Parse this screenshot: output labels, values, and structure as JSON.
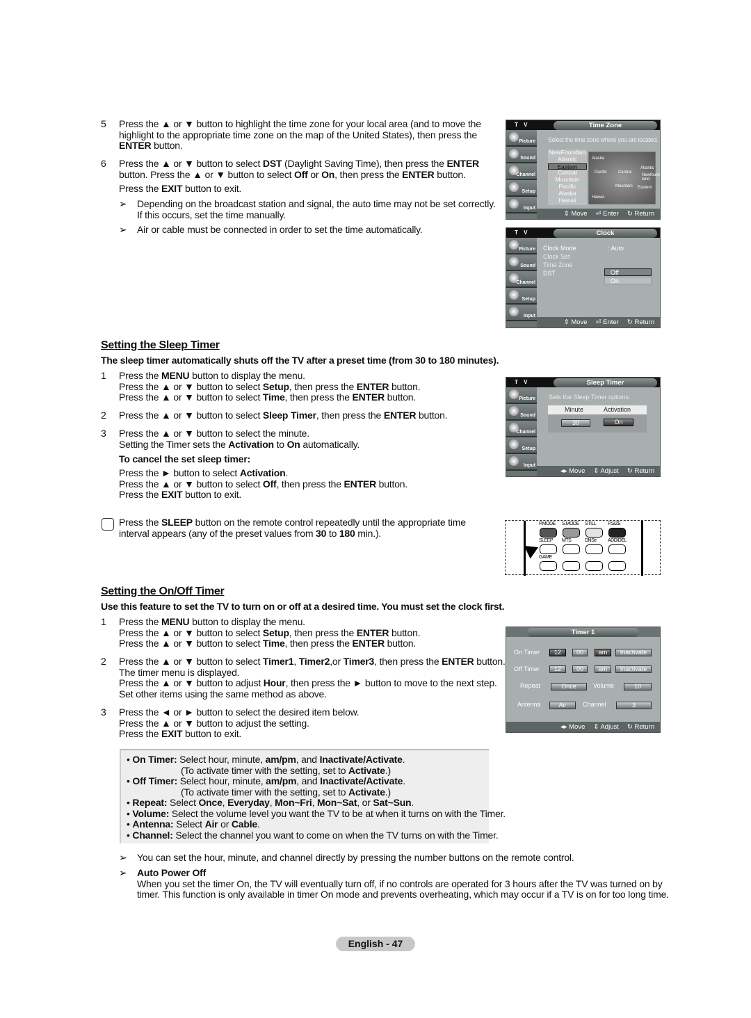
{
  "clock_steps": [
    {
      "num": "5",
      "lines": [
        [
          "Press the ▲ or ▼ button to highlight the time zone for your local area (and to move the"
        ],
        [
          "highlight to the appropriate time zone on the map of the United States), then press the"
        ],
        [
          "",
          "ENTER",
          " button."
        ]
      ]
    },
    {
      "num": "6",
      "lines": [
        [
          "Press the ▲ or ▼ button to select ",
          "DST",
          " (Daylight Saving Time), then press the ",
          "ENTER"
        ],
        [
          "button. Press the ▲ or ▼ button to select ",
          "Off",
          " or ",
          "On",
          ", then press the ",
          "ENTER",
          " button."
        ]
      ]
    },
    {
      "num": "",
      "lines": [
        [
          "Press the ",
          "EXIT",
          " button to exit."
        ]
      ]
    }
  ],
  "clock_notes": [
    {
      "arrow": "➢",
      "lines": [
        [
          "Depending on the broadcast station and signal, the auto time may not be set correctly."
        ],
        [
          "If this occurs, set the time manually."
        ]
      ]
    },
    {
      "arrow": "➢",
      "lines": [
        [
          "Air or cable must be connected in order to set the time automatically."
        ]
      ]
    }
  ],
  "sleep": {
    "heading": "Setting the Sleep Timer",
    "intro": "The sleep timer automatically shuts off the TV after a preset time (from 30 to 180 minutes).",
    "steps": [
      {
        "num": "1",
        "lines": [
          [
            "Press the ",
            "MENU",
            " button to display the menu."
          ],
          [
            "Press the ▲ or ▼ button to select ",
            "Setup",
            ", then press the ",
            "ENTER",
            " button."
          ],
          [
            "Press the ▲ or ▼ button to select ",
            "Time",
            ", then press the ",
            "ENTER",
            " button."
          ]
        ]
      },
      {
        "num": "2",
        "lines": [
          [
            "Press the ▲ or ▼ button to select ",
            "Sleep Timer",
            ", then press the ",
            "ENTER",
            " button."
          ]
        ]
      },
      {
        "num": "3",
        "lines": [
          [
            "Press the ▲ or ▼ button to select the minute."
          ],
          [
            "Setting the Timer sets the ",
            "Activation",
            " to ",
            "On",
            " automatically."
          ]
        ]
      },
      {
        "num": "",
        "lines": [
          [
            "",
            "To cancel the set sleep timer:"
          ]
        ]
      },
      {
        "num": "",
        "lines": [
          [
            "Press the ► button to select ",
            "Activation",
            "."
          ],
          [
            "Press the ▲ or ▼ button to select ",
            "Off",
            ", then press the ",
            "ENTER",
            " button."
          ],
          [
            "Press the ",
            "EXIT",
            " button to exit."
          ]
        ]
      }
    ],
    "remote_note": {
      "lines": [
        [
          "Press the ",
          "SLEEP",
          " button on the remote control repeatedly until the appropriate time"
        ],
        [
          "interval appears (any of the preset values from ",
          "30",
          " to ",
          "180",
          " min.)."
        ]
      ]
    }
  },
  "onoff": {
    "heading": "Setting the On/Off Timer",
    "intro": "Use this feature to set the TV to turn on or off at a desired time. You must set the clock first.",
    "steps": [
      {
        "num": "1",
        "lines": [
          [
            "Press the ",
            "MENU",
            " button to display the menu."
          ],
          [
            "Press the ▲ or ▼ button to select ",
            "Setup",
            ", then press the ",
            "ENTER",
            " button."
          ],
          [
            "Press the ▲ or ▼ button to select ",
            "Time",
            ", then press the ",
            "ENTER",
            " button."
          ]
        ]
      },
      {
        "num": "2",
        "lines": [
          [
            "Press the ▲ or ▼ button to select ",
            "Timer1",
            ", ",
            "Timer2",
            ",or ",
            "Timer3",
            ", then press the ",
            "ENTER",
            " button."
          ],
          [
            "The timer menu is displayed."
          ],
          [
            "Press the ▲ or ▼ button to adjust ",
            "Hour",
            ", then press the ► button to move to the next step."
          ],
          [
            "Set other items using the same method as above."
          ]
        ]
      },
      {
        "num": "3",
        "lines": [
          [
            "Press the ◄ or ► button to select the desired item below."
          ],
          [
            "Press the ▲ or ▼ button to adjust the setting."
          ],
          [
            "Press the ",
            "EXIT",
            " button to exit."
          ]
        ]
      }
    ],
    "bullets": [
      [
        "• ",
        "On Timer:",
        " Select hour, minute, ",
        "am/pm",
        ", and ",
        "Inactivate/Activate",
        "."
      ],
      [
        "(To activate timer with the setting, set to ",
        "Activate",
        ".)"
      ],
      [
        "• ",
        "Off Timer:",
        " Select hour, minute, ",
        "am/pm",
        ", and ",
        "Inactivate/Activate",
        "."
      ],
      [
        "(To activate timer with the setting, set to ",
        "Activate",
        ".)"
      ],
      [
        "• ",
        "Repeat:",
        " Select ",
        "Once",
        ", ",
        "Everyday",
        ", ",
        "Mon~Fri",
        ", ",
        "Mon~Sat",
        ", or ",
        "Sat~Sun",
        "."
      ],
      [
        "• ",
        "Volume:",
        " Select the volume level you want the TV to be at when it turns on with the Timer."
      ],
      [
        "• ",
        "Antenna:",
        " Select ",
        "Air",
        " or ",
        "Cable",
        "."
      ],
      [
        "• ",
        "Channel:",
        " Select the channel you want to come on when the TV turns on with the Timer."
      ]
    ],
    "notes": [
      {
        "arrow": "➢",
        "lines": [
          [
            "You can set the hour, minute, and channel directly by pressing the number buttons on the remote control."
          ]
        ]
      },
      {
        "arrow": "➢",
        "lines": [
          [
            "",
            "Auto Power Off"
          ],
          [
            "When you set the timer On, the TV will eventually turn off, if no controls are operated for 3 hours after the TV was turned on by"
          ],
          [
            "timer. This function is only available in timer On mode and prevents overheating, which may occur if a TV is on for too long time."
          ]
        ]
      }
    ]
  },
  "sidebar_tabs": [
    "Picture",
    "Sound",
    "Channel",
    "Setup",
    "Input"
  ],
  "menu_timezone": {
    "tv": "T V",
    "title": "Time Zone",
    "subtitle": "Select the time zone where you are located.",
    "zones": [
      "NewFoundlan",
      "Atlantic",
      "Eastern",
      "Central",
      "Mountain",
      "Pacific",
      "Alaska",
      "Hawaii"
    ],
    "selected": "Eastern",
    "map_labels": [
      "Alaska",
      "Pacific",
      "Central",
      "Atlantic",
      "Newfound-land",
      "Mountain",
      "Eastern",
      "Hawaii"
    ],
    "footer": [
      "⇕ Move",
      "⏎ Enter",
      "↻ Return"
    ]
  },
  "menu_clock": {
    "tv": "T V",
    "title": "Clock",
    "rows": [
      "Clock Mode",
      "Clock Set",
      "Time Zone",
      "DST"
    ],
    "clock_mode_value": ": Auto",
    "dst_options": [
      "Off",
      "On"
    ],
    "footer": [
      "⇕ Move",
      "⏎ Enter",
      "↻ Return"
    ]
  },
  "menu_sleep": {
    "tv": "T V",
    "title": "Sleep Timer",
    "subtitle": "Sets the Sleep Timer options.",
    "col_minute": "Minute",
    "col_activation": "Activation",
    "minute": "30",
    "activation": "On",
    "footer": [
      "◂▸ Move",
      "⇕ Adjust",
      "↻ Return"
    ]
  },
  "remote": {
    "row1": [
      "P.MODE",
      "S.MODE",
      "STILL",
      "P.SIZE"
    ],
    "row1_colors": [
      "#555555",
      "#999999",
      "#e4e4e4",
      "#222222"
    ],
    "row2": [
      "SLEEP",
      "MTS",
      "DNSe",
      "ADD/DEL"
    ],
    "row3": [
      "GAME"
    ]
  },
  "menu_timer": {
    "title": "Timer 1",
    "on_label": "On Timer",
    "on_hour": "12",
    "on_min": "00",
    "on_ampm": "am",
    "on_state": "Inactivate",
    "off_label": "Off Timer",
    "off_hour": "12",
    "off_min": "00",
    "off_ampm": "am",
    "off_state": "Inactivate",
    "repeat_label": "Repeat",
    "repeat": "Once",
    "volume_label": "Volume",
    "volume": "10",
    "antenna_label": "Antenna",
    "antenna": "Air",
    "channel_label": "Channel",
    "channel": "3",
    "footer": [
      "◂▸ Move",
      "⇕ Adjust",
      "↻ Return"
    ]
  },
  "footer": {
    "page": "English - 47"
  }
}
